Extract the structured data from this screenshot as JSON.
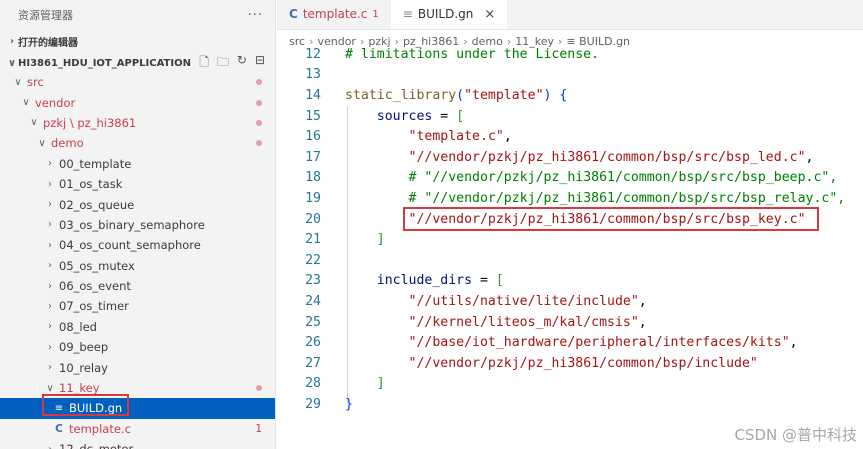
{
  "sidebar": {
    "title": "资源管理器",
    "more": "···",
    "open_editors": "打开的编辑器",
    "root": "HI3861_HDU_IOT_APPLICATION",
    "tree": [
      {
        "label": "src",
        "indent": 1,
        "chev": "∨",
        "modified": true,
        "dot": true
      },
      {
        "label": "vendor",
        "indent": 2,
        "chev": "∨",
        "modified": true,
        "dot": true
      },
      {
        "label": "pzkj \\ pz_hi3861",
        "indent": 3,
        "chev": "∨",
        "modified": true,
        "dot": true
      },
      {
        "label": "demo",
        "indent": 4,
        "chev": "∨",
        "modified": true,
        "dot": true
      },
      {
        "label": "00_template",
        "indent": 5,
        "chev": ">"
      },
      {
        "label": "01_os_task",
        "indent": 5,
        "chev": ">"
      },
      {
        "label": "02_os_queue",
        "indent": 5,
        "chev": ">"
      },
      {
        "label": "03_os_binary_semaphore",
        "indent": 5,
        "chev": ">"
      },
      {
        "label": "04_os_count_semaphore",
        "indent": 5,
        "chev": ">"
      },
      {
        "label": "05_os_mutex",
        "indent": 5,
        "chev": ">"
      },
      {
        "label": "06_os_event",
        "indent": 5,
        "chev": ">"
      },
      {
        "label": "07_os_timer",
        "indent": 5,
        "chev": ">"
      },
      {
        "label": "08_led",
        "indent": 5,
        "chev": ">"
      },
      {
        "label": "09_beep",
        "indent": 5,
        "chev": ">"
      },
      {
        "label": "10_relay",
        "indent": 5,
        "chev": ">"
      },
      {
        "label": "11_key",
        "indent": 5,
        "chev": "∨",
        "modified": true,
        "dot": true
      },
      {
        "label": "BUILD.gn",
        "indent": 6,
        "icon": "≡",
        "selected": true
      },
      {
        "label": "template.c",
        "indent": 6,
        "icon": "C",
        "modified": true,
        "count": "1"
      },
      {
        "label": "12_dc_motor",
        "indent": 5,
        "chev": ">"
      }
    ]
  },
  "tabs": [
    {
      "icon": "C",
      "label": "template.c",
      "badge": "1",
      "active": false
    },
    {
      "icon": "≡",
      "label": "BUILD.gn",
      "close": "×",
      "active": true
    }
  ],
  "breadcrumb": [
    "src",
    "vendor",
    "pzkj",
    "pz_hi3861",
    "demo",
    "11_key",
    "≡ BUILD.gn"
  ],
  "code": [
    {
      "n": "12",
      "t": "# limitations under the License.",
      "k": "cmt",
      "ind": 0
    },
    {
      "n": "13",
      "t": "",
      "ind": 0
    },
    {
      "n": "14",
      "ind": 0,
      "parts": [
        [
          "static_library",
          "fn"
        ],
        [
          "(",
          "br1"
        ],
        [
          "\"template\"",
          "str"
        ],
        [
          ")",
          "br1"
        ],
        [
          " {",
          "br1"
        ]
      ]
    },
    {
      "n": "15",
      "ind": 1,
      "parts": [
        [
          "sources",
          "var"
        ],
        [
          " = ",
          ""
        ],
        [
          "[",
          "br2"
        ]
      ]
    },
    {
      "n": "16",
      "ind": 2,
      "parts": [
        [
          "\"template.c\"",
          "str"
        ],
        [
          ",",
          ""
        ]
      ]
    },
    {
      "n": "17",
      "ind": 2,
      "parts": [
        [
          "\"//vendor/pzkj/pz_hi3861/common/bsp/src/bsp_led.c\"",
          "str"
        ],
        [
          ",",
          ""
        ]
      ]
    },
    {
      "n": "18",
      "ind": 2,
      "parts": [
        [
          "# \"//vendor/pzkj/pz_hi3861/common/bsp/src/bsp_beep.c\",",
          "cmt"
        ]
      ]
    },
    {
      "n": "19",
      "ind": 2,
      "parts": [
        [
          "# \"//vendor/pzkj/pz_hi3861/common/bsp/src/bsp_relay.c\",",
          "cmt"
        ]
      ]
    },
    {
      "n": "20",
      "ind": 2,
      "parts": [
        [
          "\"//vendor/pzkj/pz_hi3861/common/bsp/src/bsp_key.c\"",
          "str"
        ]
      ]
    },
    {
      "n": "21",
      "ind": 1,
      "parts": [
        [
          "]",
          "br2"
        ]
      ]
    },
    {
      "n": "22",
      "t": "",
      "ind": 0
    },
    {
      "n": "23",
      "ind": 1,
      "parts": [
        [
          "include_dirs",
          "var"
        ],
        [
          " = ",
          ""
        ],
        [
          "[",
          "br2"
        ]
      ]
    },
    {
      "n": "24",
      "ind": 2,
      "parts": [
        [
          "\"//utils/native/lite/include\"",
          "str"
        ],
        [
          ",",
          ""
        ]
      ]
    },
    {
      "n": "25",
      "ind": 2,
      "parts": [
        [
          "\"//kernel/liteos_m/kal/cmsis\"",
          "str"
        ],
        [
          ",",
          ""
        ]
      ]
    },
    {
      "n": "26",
      "ind": 2,
      "parts": [
        [
          "\"//base/iot_hardware/peripheral/interfaces/kits\"",
          "str"
        ],
        [
          ",",
          ""
        ]
      ]
    },
    {
      "n": "27",
      "ind": 2,
      "parts": [
        [
          "\"//vendor/pzkj/pz_hi3861/common/bsp/include\"",
          "str"
        ]
      ]
    },
    {
      "n": "28",
      "ind": 1,
      "parts": [
        [
          "]",
          "br2"
        ]
      ]
    },
    {
      "n": "29",
      "ind": 0,
      "parts": [
        [
          "}",
          "br1"
        ]
      ]
    }
  ],
  "watermark": "CSDN @普中科技",
  "colors": {
    "accent": "#0060c0",
    "highlight": "#d9363e",
    "modified": "#c4414b"
  }
}
